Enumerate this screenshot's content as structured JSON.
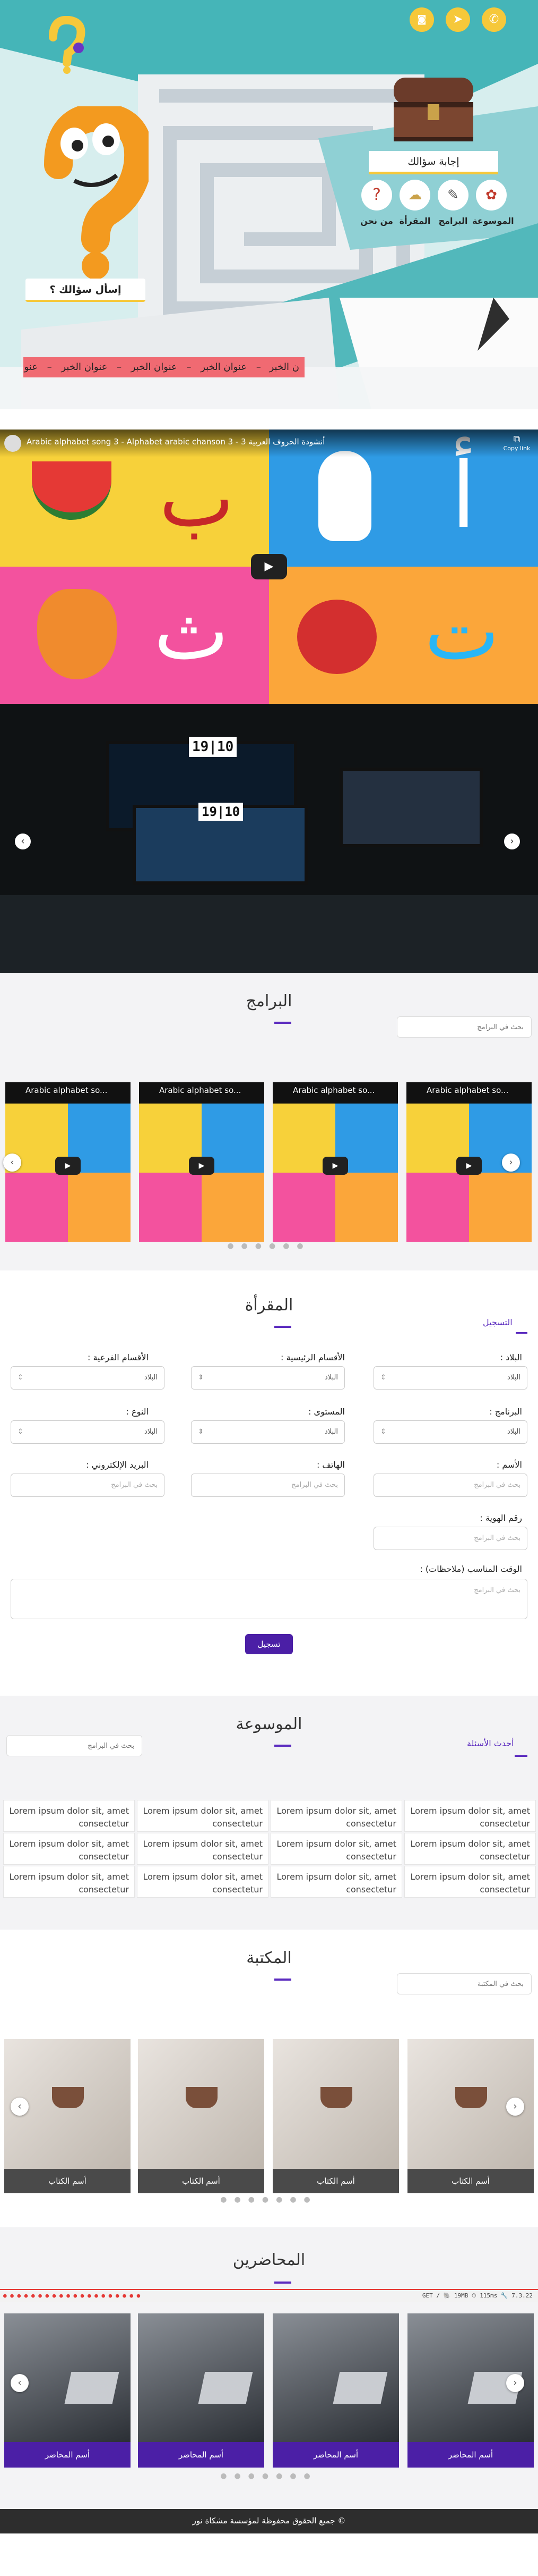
{
  "header": {
    "ask_question_label": "إسأل سؤالك ؟",
    "answer_question_label": "إجابة سؤالك",
    "nav": [
      {
        "label": "الموسوعة",
        "icon": "encyclopedia-icon"
      },
      {
        "label": "البرامج",
        "icon": "programs-icon"
      },
      {
        "label": "المقرأة",
        "icon": "maqraa-icon"
      },
      {
        "label": "من نحن",
        "icon": "about-icon"
      }
    ],
    "news_items": [
      "عنوان الخبر",
      "عنوان الخبر",
      "عنوان الخبر",
      "عنوان الخبر"
    ],
    "news_partial_left": "عنوان الخ",
    "news_partial_right": "ن الخبر"
  },
  "hero_video": {
    "title": "Arabic alphabet song 3 - Alphabet arabic chanson 3 - أنشودة الحروف العربية 3",
    "copy_link": "Copy link",
    "letters": [
      "ب",
      "أ",
      "ث",
      "ت"
    ]
  },
  "slider": {
    "clock_text": "19|10"
  },
  "programs": {
    "title": "البرامج",
    "search_placeholder": "بحث في البرامج",
    "video_title": "Arabic alphabet so..."
  },
  "maqraa": {
    "title": "المقرأة",
    "register_link": "التسجيل",
    "fields": {
      "country": "البلاد :",
      "main_sections": "الأقسام الرئيسية :",
      "sub_sections": "الأقسام الفرعية :",
      "program": "البرنامج :",
      "level": "المستوى :",
      "type": "النوع :",
      "name": "الأسم :",
      "phone": "الهاتف :",
      "email": "البريد الإلكتروني :",
      "id_number": "رقم الهوية :",
      "suitable_time": "الوقت المناسب (ملاحظات) :"
    },
    "select_value": "البلاد",
    "input_placeholder": "بحث في البرامج",
    "submit_label": "تسجيل"
  },
  "encyclopedia": {
    "title": "الموسوعة",
    "latest_questions": "أحدث الأسئلة",
    "search_placeholder": "بحث في البرامج",
    "item_text_line1": "Lorem ipsum dolor sit, amet",
    "item_text_line2": "consectetur"
  },
  "library": {
    "title": "المكتبة",
    "search_placeholder": "بحث في المكتبة",
    "book_caption": "أسم الكتاب"
  },
  "lecturers": {
    "title": "المحاضرين",
    "lecturer_caption": "أسم المحاضر",
    "debug_text": "GET / 🐘 19MB ⏱ 115ms 🔧 7.3.22"
  },
  "footer": {
    "copyright": "© جميع الحقوق محفوظة لمؤسسة مشكاة نور"
  },
  "colors": {
    "accent": "#5b2bbf",
    "teal": "#3fb6b9",
    "yellow": "#f6d33a",
    "footer_bg": "#2d2d2d"
  }
}
